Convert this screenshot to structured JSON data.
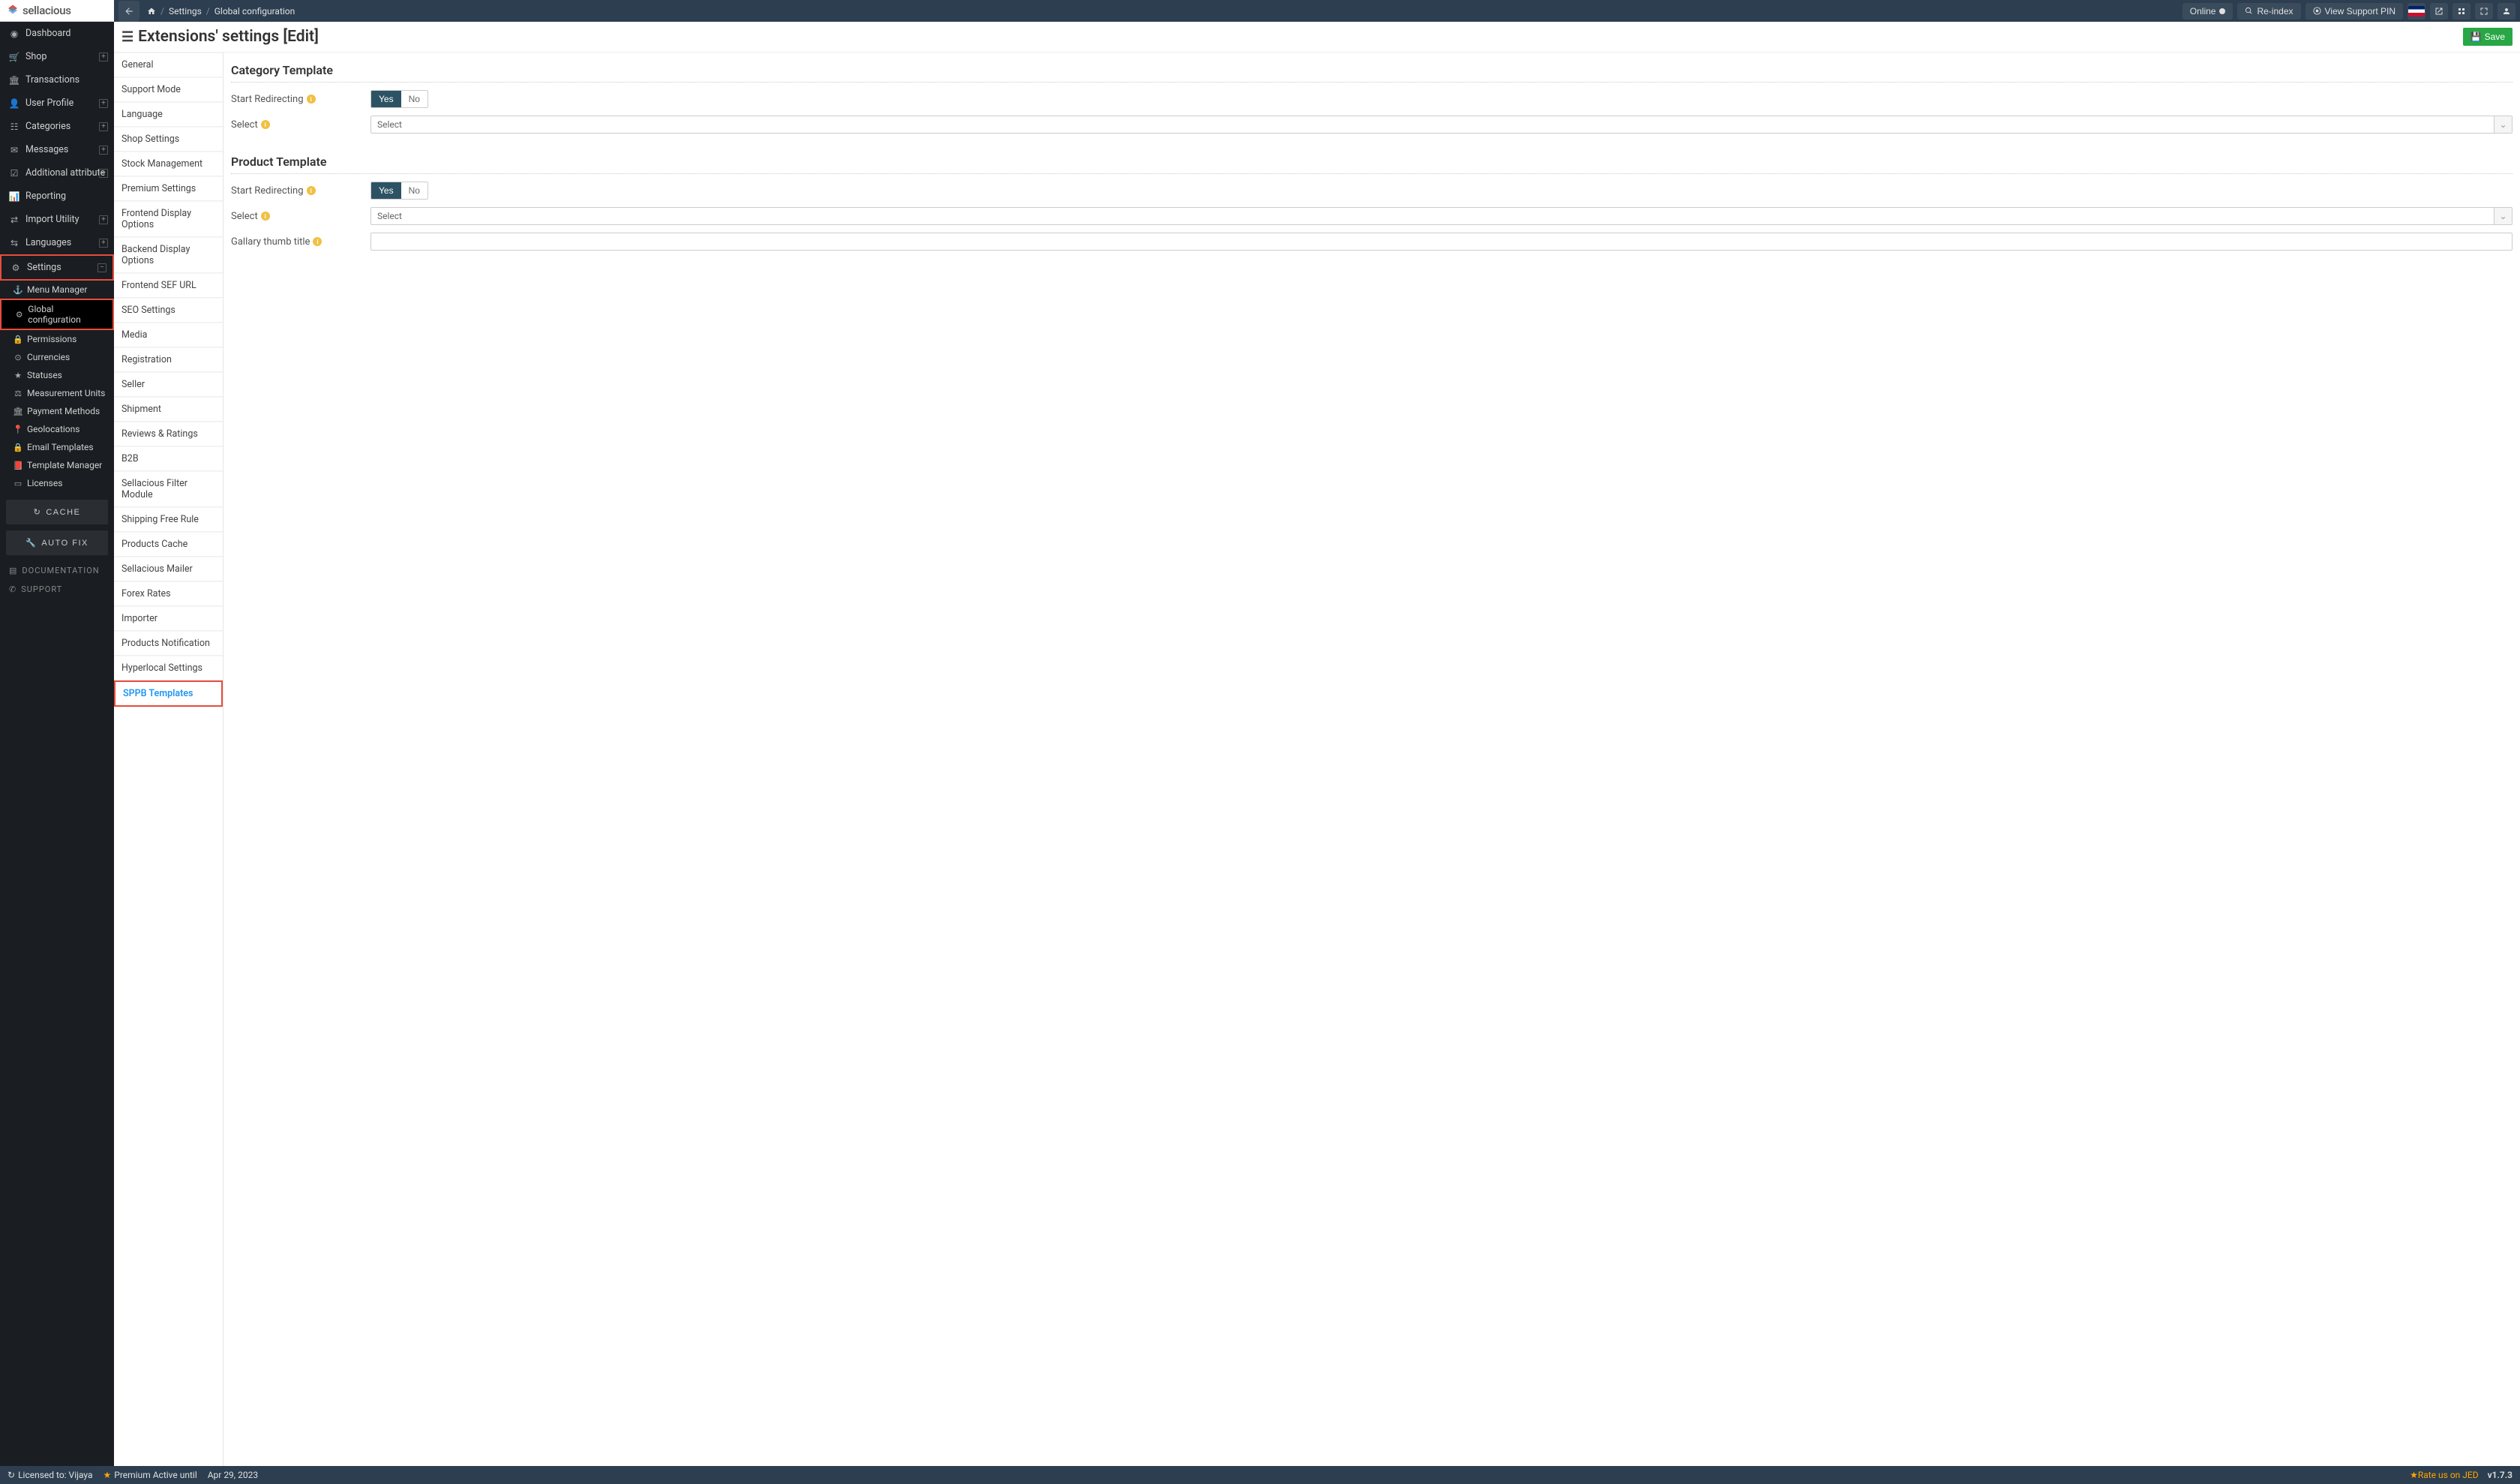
{
  "logo_text": "sellacious",
  "breadcrumb": {
    "settings": "Settings",
    "page": "Global configuration"
  },
  "topbar": {
    "online": "Online",
    "reindex": "Re-index",
    "view_pin": "View Support PIN"
  },
  "page_title": "Extensions' settings [Edit]",
  "save_label": "Save",
  "sidebar": {
    "dashboard": "Dashboard",
    "shop": "Shop",
    "transactions": "Transactions",
    "user_profile": "User Profile",
    "categories": "Categories",
    "messages": "Messages",
    "additional_attr": "Additional attribute",
    "reporting": "Reporting",
    "import_utility": "Import Utility",
    "languages": "Languages",
    "settings": "Settings",
    "sub": {
      "menu_manager": "Menu Manager",
      "global_config": "Global configuration",
      "permissions": "Permissions",
      "currencies": "Currencies",
      "statuses": "Statuses",
      "measurement": "Measurement Units",
      "payment_methods": "Payment Methods",
      "geolocations": "Geolocations",
      "email_templates": "Email Templates",
      "template_manager": "Template Manager",
      "licenses": "Licenses"
    },
    "cache_btn": "CACHE",
    "autofix_btn": "AUTO FIX",
    "documentation": "DOCUMENTATION",
    "support": "SUPPORT"
  },
  "tabs": {
    "general": "General",
    "support_mode": "Support Mode",
    "language": "Language",
    "shop_settings": "Shop Settings",
    "stock": "Stock Management",
    "premium": "Premium Settings",
    "frontend_display": "Frontend Display Options",
    "backend_display": "Backend Display Options",
    "frontend_sef": "Frontend SEF URL",
    "seo": "SEO Settings",
    "media": "Media",
    "registration": "Registration",
    "seller": "Seller",
    "shipment": "Shipment",
    "reviews": "Reviews & Ratings",
    "b2b": "B2B",
    "filter_module": "Sellacious Filter Module",
    "shipping_free": "Shipping Free Rule",
    "products_cache": "Products Cache",
    "mailer": "Sellacious Mailer",
    "forex": "Forex Rates",
    "importer": "Importer",
    "products_notif": "Products Notification",
    "hyperlocal": "Hyperlocal Settings",
    "sppb": "SPPB Templates"
  },
  "form": {
    "cat_title": "Category Template",
    "prod_title": "Product Template",
    "start_redirect": "Start Redirecting",
    "select_label": "Select",
    "gallery_thumb": "Gallary thumb title",
    "yes": "Yes",
    "no": "No",
    "select_placeholder": "Select"
  },
  "footer": {
    "licensed": "Licensed to: Vijaya",
    "premium": "Premium Active until",
    "date": "Apr 29, 2023",
    "rate": "Rate us on JED",
    "version": "v1.7.3"
  }
}
